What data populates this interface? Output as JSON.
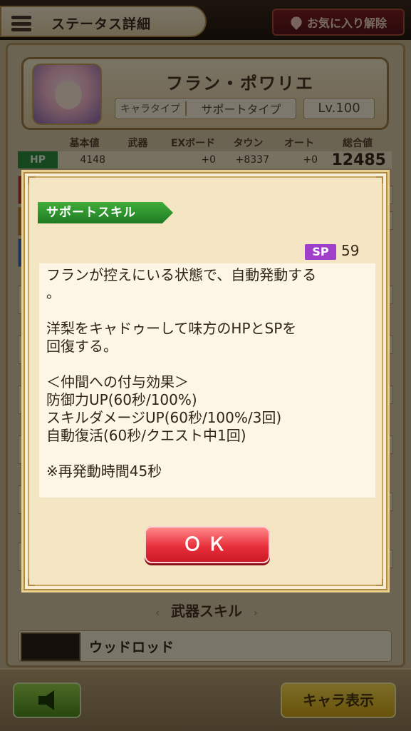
{
  "header": {
    "title": "ステータス詳細",
    "favorite_label": "お気に入り解除"
  },
  "character": {
    "name": "フラン・ポワリエ",
    "type_label": "キャラタイプ",
    "type_value": "サポートタイプ",
    "level": "Lv.100"
  },
  "stats": {
    "headers": [
      "基本値",
      "武器",
      "EXボード",
      "タウン",
      "オート",
      "総合値"
    ],
    "hp": {
      "label": "HP",
      "base": "4148",
      "weapon": "",
      "ex_board": "+0",
      "town": "+8337",
      "auto": "+0",
      "total": "12485"
    }
  },
  "modal": {
    "banner": "サポートスキル",
    "sp_label": "SP",
    "sp_value": "59",
    "description": "フランが控えにいる状態で、自動発動する\n。\n\n洋梨をキャドゥーして味方のHPとSPを\n回復する。\n\n＜仲間への付与効果＞\n防御力UP(60秒/100%)\nスキルダメージUP(60秒/100%/3回)\n自動復活(60秒/クエスト中1回)\n\n※再発動時間45秒",
    "ok_label": "ＯＫ"
  },
  "weapon": {
    "section_title": "武器スキル",
    "prev_arrow": "‹",
    "next_arrow": "›",
    "name": "ウッドロッド"
  },
  "footer": {
    "chara_button_label": "キャラ表示"
  },
  "colors": {
    "ok_button": "#e8303b",
    "banner_green": "#2f9a30",
    "sp_purple": "#a03fc9",
    "hp_green": "#2d8c3a",
    "chara_button_yellow": "#e9c531",
    "back_button_green": "#6fb131"
  },
  "icons": [
    "menu-icon",
    "heart-icon",
    "back-arrow-icon"
  ]
}
